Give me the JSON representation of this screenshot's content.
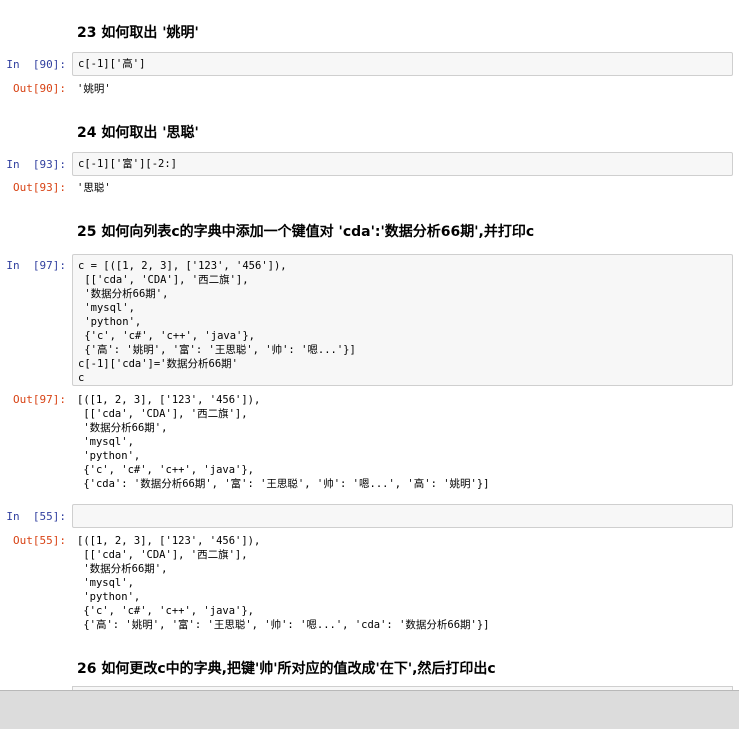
{
  "cells": [
    {
      "kind": "md",
      "text": "23  如何取出 '姚明'"
    },
    {
      "kind": "code",
      "prompt": "In  [90]:",
      "lines": [
        "c[-1]['高']"
      ]
    },
    {
      "kind": "output",
      "prompt": "Out[90]:",
      "lines": [
        "'姚明'"
      ]
    },
    {
      "kind": "md",
      "text": "24  如何取出 '思聪'"
    },
    {
      "kind": "code",
      "prompt": "In  [93]:",
      "lines": [
        "c[-1]['富'][-2:]"
      ]
    },
    {
      "kind": "output",
      "prompt": "Out[93]:",
      "lines": [
        "'思聪'"
      ]
    },
    {
      "kind": "md",
      "text": "25  如何向列表c的字典中添加一个键值对 'cda':'数据分析66期',并打印c"
    },
    {
      "kind": "code",
      "prompt": "In  [97]:",
      "lines": [
        "c = [([1, 2, 3], ['123', '456']),",
        " [['cda', 'CDA'], '西二旗'],",
        " '数据分析66期',",
        " 'mysql',",
        " 'python',",
        " {'c', 'c#', 'c++', 'java'},",
        " {'高': '姚明', '富': '王思聪', '帅': '嗯...'}]",
        "c[-1]['cda']='数据分析66期'",
        "c"
      ]
    },
    {
      "kind": "output",
      "prompt": "Out[97]:",
      "lines": [
        "[([1, 2, 3], ['123', '456']),",
        " [['cda', 'CDA'], '西二旗'],",
        " '数据分析66期',",
        " 'mysql',",
        " 'python',",
        " {'c', 'c#', 'c++', 'java'},",
        " {'cda': '数据分析66期', '富': '王思聪', '帅': '嗯...', '高': '姚明'}]"
      ]
    },
    {
      "kind": "code",
      "prompt": "In  [55]:",
      "lines": [
        ""
      ]
    },
    {
      "kind": "output",
      "prompt": "Out[55]:",
      "lines": [
        "[([1, 2, 3], ['123', '456']),",
        " [['cda', 'CDA'], '西二旗'],",
        " '数据分析66期',",
        " 'mysql',",
        " 'python',",
        " {'c', 'c#', 'c++', 'java'},",
        " {'高': '姚明', '富': '王思聪', '帅': '嗯...', 'cda': '数据分析66期'}]"
      ]
    },
    {
      "kind": "md",
      "text": "26  如何更改c中的字典,把键'帅'所对应的值改成'在下',然后打印出c"
    }
  ],
  "colors": {
    "in_prompt": "#303f9f",
    "out_prompt": "#d84315",
    "cell_bg": "#f7f7f7",
    "cell_border": "#cfcfcf"
  }
}
